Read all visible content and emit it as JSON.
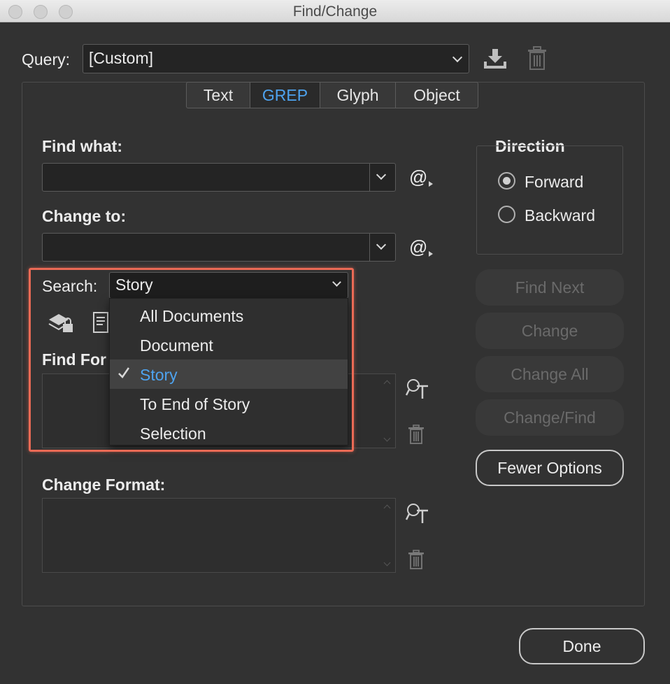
{
  "window": {
    "title": "Find/Change"
  },
  "query": {
    "label": "Query:",
    "value": "[Custom]"
  },
  "tabs": [
    {
      "label": "Text",
      "active": false
    },
    {
      "label": "GREP",
      "active": true
    },
    {
      "label": "Glyph",
      "active": false
    },
    {
      "label": "Object",
      "active": false
    }
  ],
  "find_what": {
    "label": "Find what:",
    "value": ""
  },
  "change_to": {
    "label": "Change to:",
    "value": ""
  },
  "search": {
    "label": "Search:",
    "value": "Story",
    "options": [
      "All Documents",
      "Document",
      "Story",
      "To End of Story",
      "Selection"
    ],
    "selected": "Story"
  },
  "find_format": {
    "label": "Find For"
  },
  "change_format": {
    "label": "Change Format:"
  },
  "direction": {
    "label": "Direction",
    "options": [
      {
        "label": "Forward",
        "checked": true
      },
      {
        "label": "Backward",
        "checked": false
      }
    ]
  },
  "buttons": {
    "find_next": "Find Next",
    "change": "Change",
    "change_all": "Change All",
    "change_find": "Change/Find",
    "fewer_options": "Fewer Options",
    "done": "Done"
  },
  "special_char_glyph": "@",
  "colors": {
    "background": "#323232",
    "accent": "#4ea3ef",
    "highlight": "#ea6a55",
    "disabled_text": "#6a6a6a"
  }
}
